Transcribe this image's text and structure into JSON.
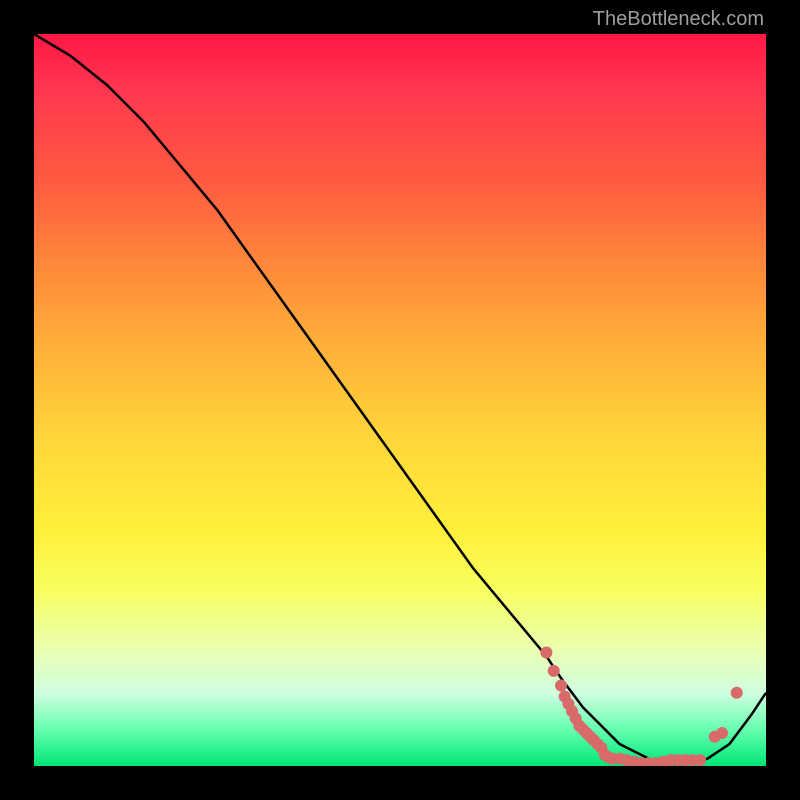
{
  "attribution": "TheBottleneck.com",
  "chart_data": {
    "type": "line",
    "title": "",
    "xlabel": "",
    "ylabel": "",
    "xlim": [
      0,
      100
    ],
    "ylim": [
      0,
      100
    ],
    "series": [
      {
        "name": "curve",
        "x": [
          0,
          5,
          10,
          15,
          20,
          25,
          30,
          35,
          40,
          45,
          50,
          55,
          60,
          65,
          70,
          72,
          75,
          78,
          80,
          82,
          85,
          88,
          90,
          92,
          95,
          98,
          100
        ],
        "y": [
          100,
          97,
          93,
          88,
          82,
          76,
          69,
          62,
          55,
          48,
          41,
          34,
          27,
          21,
          15,
          12,
          8,
          5,
          3,
          2,
          0.5,
          0.2,
          0.5,
          1,
          3,
          7,
          10
        ]
      }
    ],
    "markers": {
      "name": "scatter-points",
      "color": "#d86a6a",
      "points": [
        {
          "x": 70.0,
          "y": 15.5
        },
        {
          "x": 71.0,
          "y": 13.0
        },
        {
          "x": 72.0,
          "y": 11.0
        },
        {
          "x": 72.5,
          "y": 9.5
        },
        {
          "x": 73.0,
          "y": 8.5
        },
        {
          "x": 73.5,
          "y": 7.5
        },
        {
          "x": 74.0,
          "y": 6.5
        },
        {
          "x": 74.5,
          "y": 5.5
        },
        {
          "x": 75.0,
          "y": 5.0
        },
        {
          "x": 75.5,
          "y": 4.5
        },
        {
          "x": 76.0,
          "y": 4.0
        },
        {
          "x": 76.5,
          "y": 3.5
        },
        {
          "x": 77.0,
          "y": 3.0
        },
        {
          "x": 77.5,
          "y": 2.5
        },
        {
          "x": 78.0,
          "y": 1.5
        },
        {
          "x": 78.5,
          "y": 1.2
        },
        {
          "x": 79.0,
          "y": 1.0
        },
        {
          "x": 80.0,
          "y": 1.0
        },
        {
          "x": 81.0,
          "y": 0.8
        },
        {
          "x": 82.0,
          "y": 0.6
        },
        {
          "x": 83.0,
          "y": 0.4
        },
        {
          "x": 84.0,
          "y": 0.4
        },
        {
          "x": 85.0,
          "y": 0.4
        },
        {
          "x": 86.0,
          "y": 0.6
        },
        {
          "x": 87.0,
          "y": 0.8
        },
        {
          "x": 88.0,
          "y": 0.8
        },
        {
          "x": 89.0,
          "y": 0.8
        },
        {
          "x": 90.0,
          "y": 0.8
        },
        {
          "x": 91.0,
          "y": 0.8
        },
        {
          "x": 93.0,
          "y": 4.0
        },
        {
          "x": 94.0,
          "y": 4.5
        },
        {
          "x": 96.0,
          "y": 10.0
        }
      ]
    }
  }
}
